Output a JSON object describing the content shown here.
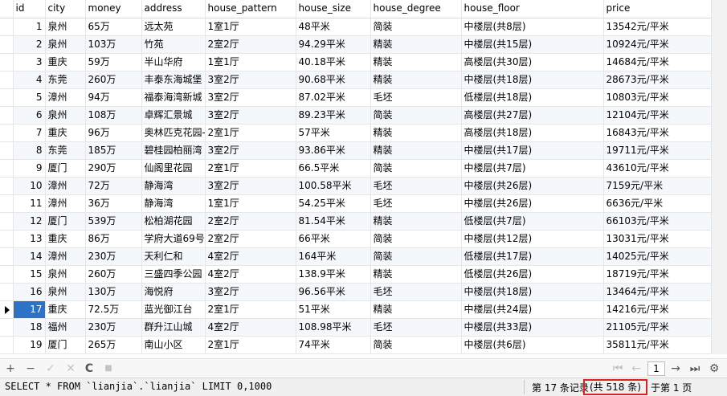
{
  "columns": [
    "id",
    "city",
    "money",
    "address",
    "house_pattern",
    "house_size",
    "house_degree",
    "house_floor",
    "price"
  ],
  "rows": [
    [
      "1",
      "泉州",
      "65万",
      "远太苑",
      "1室1厅",
      "48平米",
      "简装",
      "中楼层(共8层)",
      "13542元/平米"
    ],
    [
      "2",
      "泉州",
      "103万",
      "竹苑",
      "2室2厅",
      "94.29平米",
      "精装",
      "中楼层(共15层)",
      "10924元/平米"
    ],
    [
      "3",
      "重庆",
      "59万",
      "半山华府",
      "1室1厅",
      "40.18平米",
      "精装",
      "高楼层(共30层)",
      "14684元/平米"
    ],
    [
      "4",
      "东莞",
      "260万",
      "丰泰东海城堡",
      "3室2厅",
      "90.68平米",
      "精装",
      "中楼层(共18层)",
      "28673元/平米"
    ],
    [
      "5",
      "漳州",
      "94万",
      "福泰海湾新城",
      "3室2厅",
      "87.02平米",
      "毛坯",
      "低楼层(共18层)",
      "10803元/平米"
    ],
    [
      "6",
      "泉州",
      "108万",
      "卓辉汇景城",
      "3室2厅",
      "89.23平米",
      "简装",
      "高楼层(共27层)",
      "12104元/平米"
    ],
    [
      "7",
      "重庆",
      "96万",
      "奥林匹克花园-",
      "2室1厅",
      "57平米",
      "精装",
      "高楼层(共18层)",
      "16843元/平米"
    ],
    [
      "8",
      "东莞",
      "185万",
      "碧桂园柏丽湾",
      "3室2厅",
      "93.86平米",
      "精装",
      "中楼层(共17层)",
      "19711元/平米"
    ],
    [
      "9",
      "厦门",
      "290万",
      "仙阁里花园",
      "2室1厅",
      "66.5平米",
      "简装",
      "中楼层(共7层)",
      "43610元/平米"
    ],
    [
      "10",
      "漳州",
      "72万",
      "静海湾",
      "3室2厅",
      "100.58平米",
      "毛坯",
      "中楼层(共26层)",
      "7159元/平米"
    ],
    [
      "11",
      "漳州",
      "36万",
      "静海湾",
      "1室1厅",
      "54.25平米",
      "毛坯",
      "中楼层(共26层)",
      "6636元/平米"
    ],
    [
      "12",
      "厦门",
      "539万",
      "松柏湖花园",
      "2室2厅",
      "81.54平米",
      "精装",
      "低楼层(共7层)",
      "66103元/平米"
    ],
    [
      "13",
      "重庆",
      "86万",
      "学府大道69号",
      "2室2厅",
      "66平米",
      "简装",
      "中楼层(共12层)",
      "13031元/平米"
    ],
    [
      "14",
      "漳州",
      "230万",
      "天利仁和",
      "4室2厅",
      "164平米",
      "简装",
      "低楼层(共17层)",
      "14025元/平米"
    ],
    [
      "15",
      "泉州",
      "260万",
      "三盛四季公园",
      "4室2厅",
      "138.9平米",
      "精装",
      "低楼层(共26层)",
      "18719元/平米"
    ],
    [
      "16",
      "泉州",
      "130万",
      "海悦府",
      "3室2厅",
      "96.56平米",
      "毛坯",
      "中楼层(共18层)",
      "13464元/平米"
    ],
    [
      "17",
      "重庆",
      "72.5万",
      "蓝光御江台",
      "2室1厅",
      "51平米",
      "精装",
      "中楼层(共24层)",
      "14216元/平米"
    ],
    [
      "18",
      "福州",
      "230万",
      "群升江山城",
      "4室2厅",
      "108.98平米",
      "毛坯",
      "中楼层(共33层)",
      "21105元/平米"
    ],
    [
      "19",
      "厦门",
      "265万",
      "南山小区",
      "2室1厅",
      "74平米",
      "简装",
      "中楼层(共6层)",
      "35811元/平米"
    ]
  ],
  "selected_row_index": 16,
  "toolbar": {
    "add": "+",
    "remove": "−",
    "apply": "✓",
    "discard": "✕",
    "refresh": "C",
    "stop": "■",
    "first": "⏮",
    "prev": "←",
    "page": "1",
    "next": "→",
    "last": "⏭",
    "settings": "⚙"
  },
  "status": {
    "sql": "SELECT * FROM `lianjia`.`lianjia` LIMIT 0,1000",
    "record_prefix": "第 17 条记录",
    "record_total": "(共 518 条)",
    "record_page": "于第 1 页"
  },
  "colors": {
    "selected_id_bg": "#2c73c8",
    "alt_row_bg": "#f4f8fc",
    "highlight_box": "#e02020"
  },
  "icons": [
    "add-icon",
    "remove-icon",
    "apply-icon",
    "discard-icon",
    "refresh-icon",
    "stop-icon",
    "first-page-icon",
    "prev-page-icon",
    "next-page-icon",
    "last-page-icon",
    "settings-icon",
    "row-pointer-icon"
  ]
}
